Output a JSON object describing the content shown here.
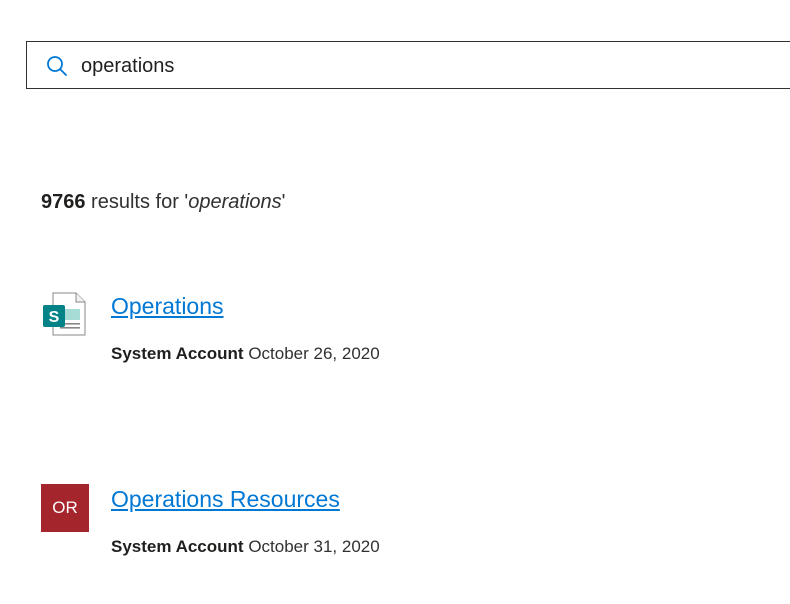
{
  "search": {
    "icon": "search-icon",
    "value": "operations"
  },
  "summary": {
    "count": "9766",
    "text_before": " results for '",
    "query": "operations",
    "text_after": "'"
  },
  "results": [
    {
      "icon": "sharepoint-page-icon",
      "title": "Operations",
      "author": "System Account",
      "date": "October 26, 2020"
    },
    {
      "icon": "site-initials-tile",
      "initials": "OR",
      "title": "Operations Resources",
      "author": "System Account",
      "date": "October 31, 2020"
    }
  ],
  "colors": {
    "link": "#0078d4",
    "sharepoint_teal": "#038387",
    "initials_tile": "#a4262c"
  }
}
